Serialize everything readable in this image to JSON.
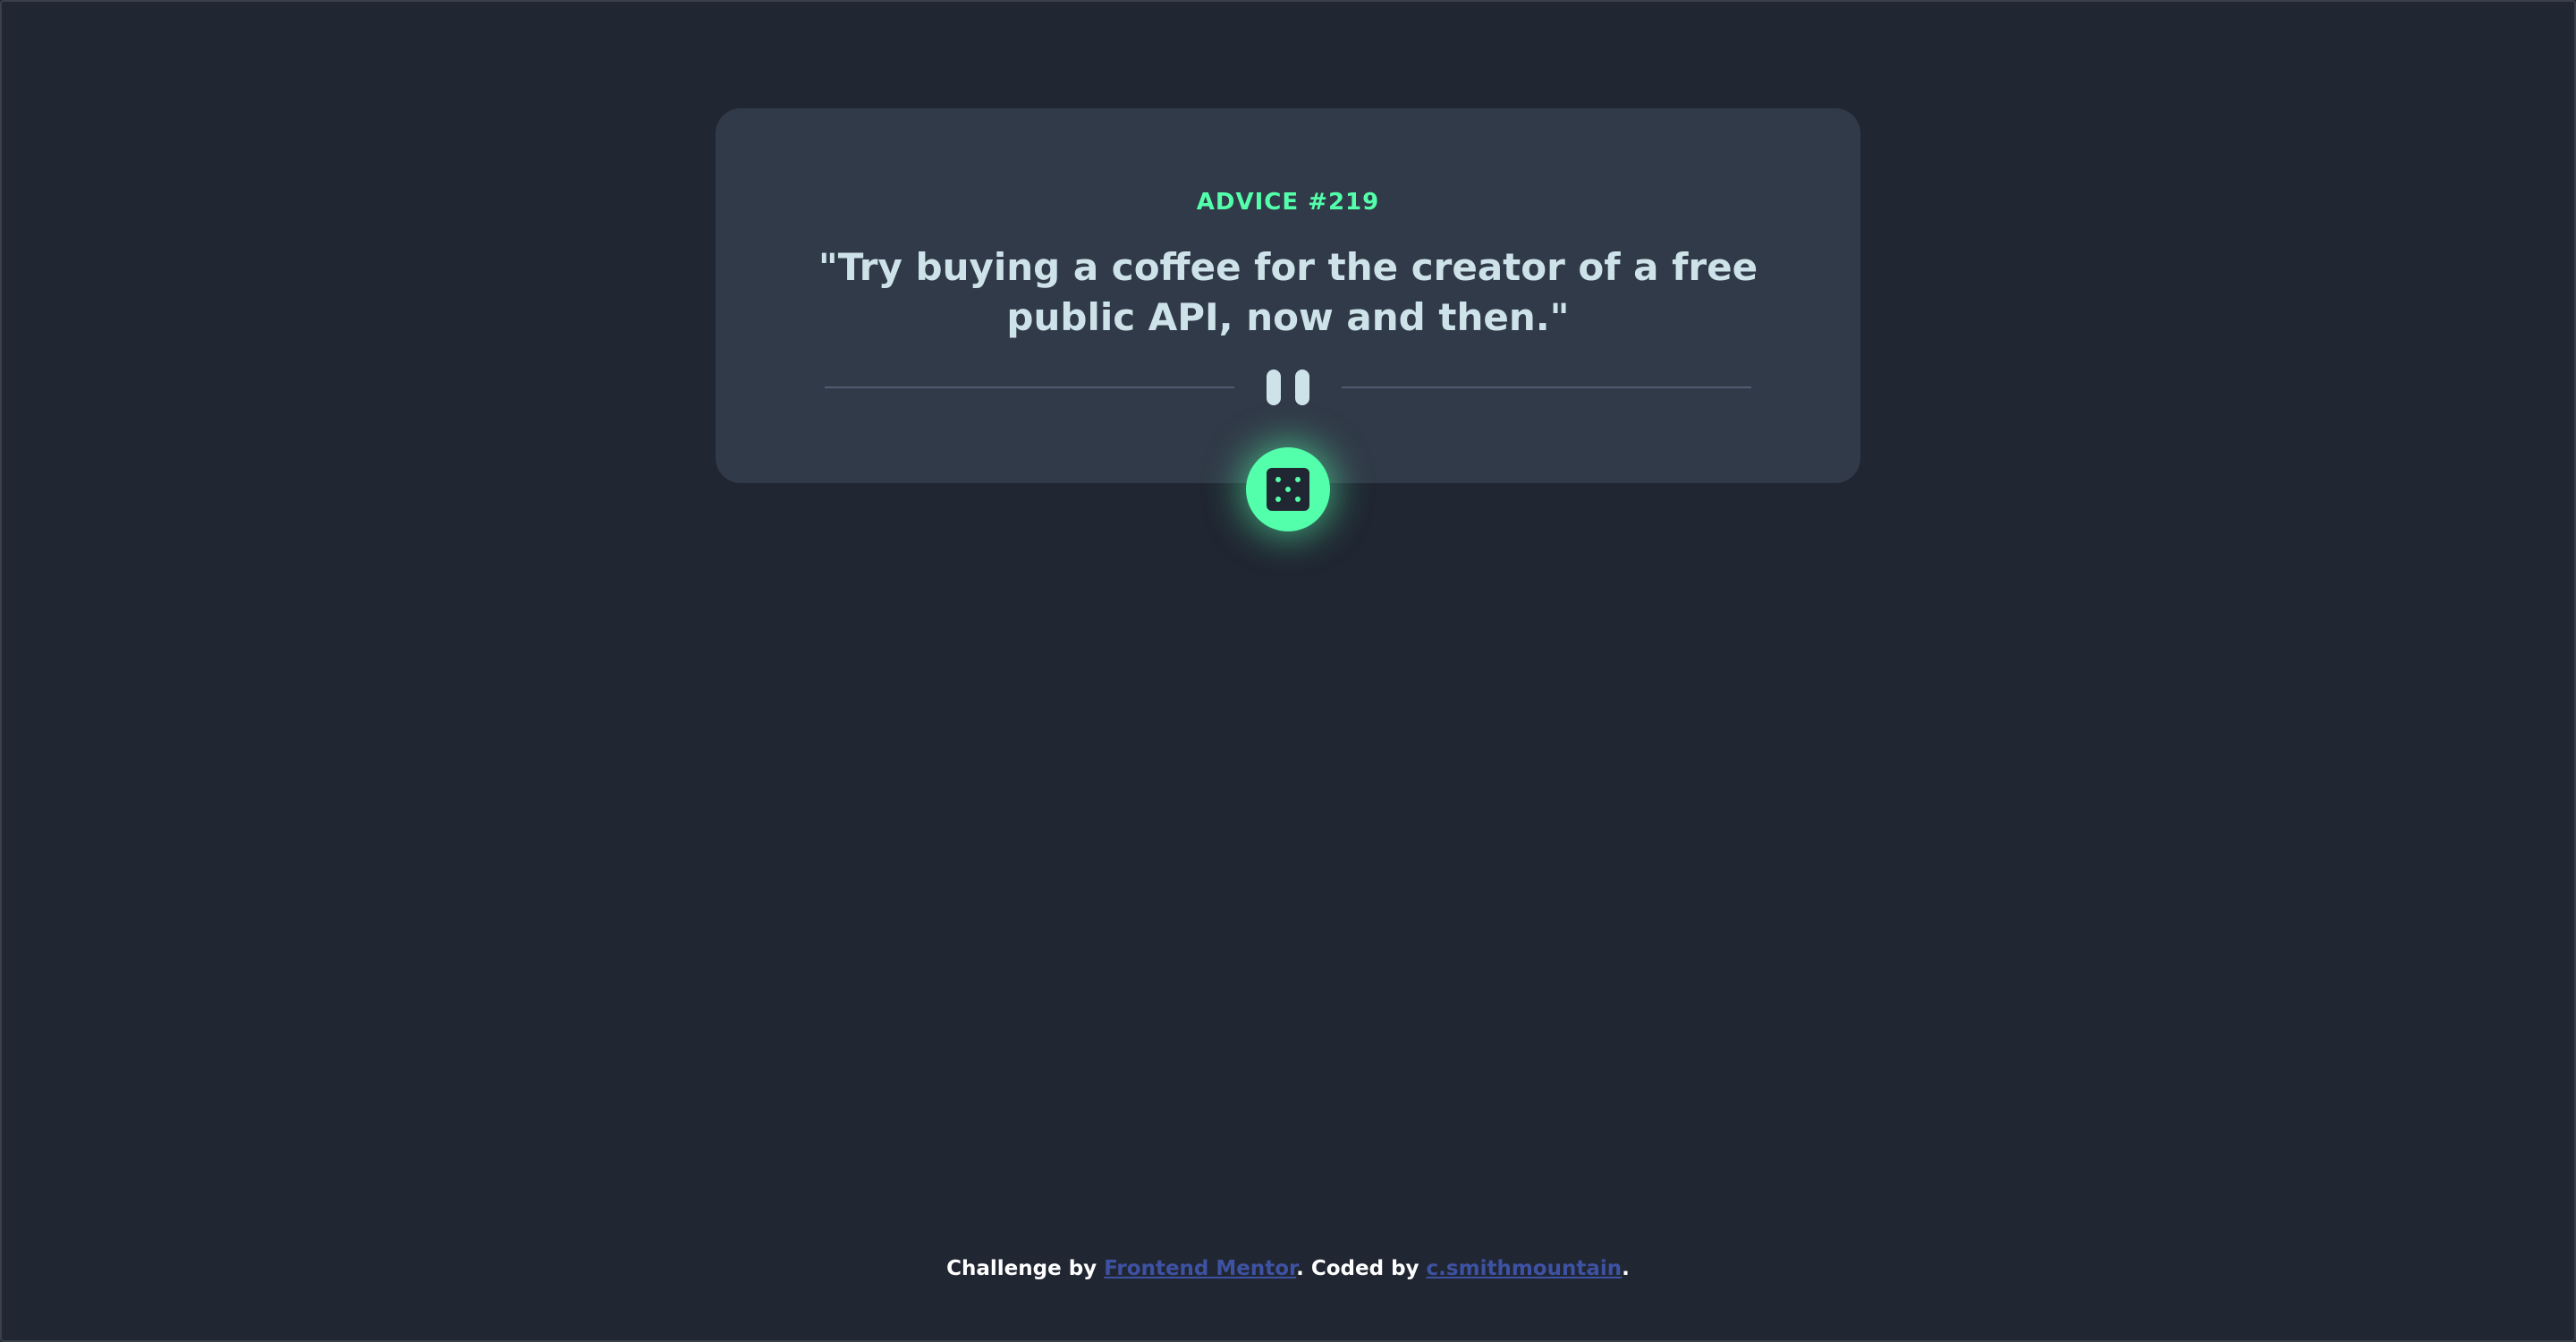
{
  "card": {
    "advice_label": "ADVICE #219",
    "quote": "\"Try buying a coffee for the creator of a free public API, now and then.\""
  },
  "footer": {
    "challenge_prefix": "Challenge by ",
    "challenge_link": "Frontend Mentor",
    "coded_prefix": ". Coded by ",
    "author_link": "c.smithmountain",
    "suffix": "."
  },
  "icons": {
    "divider_icon": "pause-icon",
    "button_icon": "dice-icon"
  },
  "colors": {
    "background": "#202632",
    "card": "#313a48",
    "accent": "#53ffaa",
    "text": "#cee3e9",
    "link": "#3e52a3"
  }
}
